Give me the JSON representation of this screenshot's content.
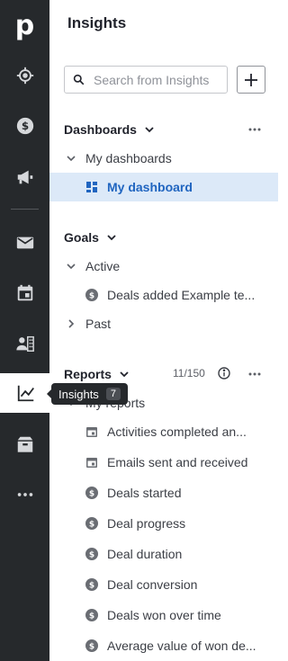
{
  "rail": {
    "logo": "p",
    "items": [
      {
        "icon": "target-icon",
        "name": "leads"
      },
      {
        "icon": "dollar-icon",
        "name": "deals"
      },
      {
        "icon": "megaphone-icon",
        "name": "campaigns"
      },
      {
        "icon": "mail-icon",
        "name": "mail"
      },
      {
        "icon": "calendar-icon",
        "name": "activities"
      },
      {
        "icon": "contacts-icon",
        "name": "contacts"
      },
      {
        "icon": "chart-icon",
        "name": "insights",
        "active": true
      },
      {
        "icon": "box-icon",
        "name": "products"
      },
      {
        "icon": "more-icon",
        "name": "more"
      }
    ]
  },
  "tooltip": {
    "label": "Insights",
    "badge": "7"
  },
  "panel": {
    "title": "Insights",
    "search_placeholder": "Search from Insights"
  },
  "dashboards": {
    "heading": "Dashboards",
    "group": "My dashboards",
    "items": [
      "My dashboard"
    ]
  },
  "goals": {
    "heading": "Goals",
    "active_label": "Active",
    "active_items": [
      "Deals added Example te..."
    ],
    "past_label": "Past"
  },
  "reports": {
    "heading": "Reports",
    "count": "11/150",
    "group": "My reports",
    "items": [
      {
        "icon": "calendar-icon",
        "label": "Activities completed an..."
      },
      {
        "icon": "calendar-icon",
        "label": "Emails sent and received"
      },
      {
        "icon": "dollar-icon",
        "label": "Deals started"
      },
      {
        "icon": "dollar-icon",
        "label": "Deal progress"
      },
      {
        "icon": "dollar-icon",
        "label": "Deal duration"
      },
      {
        "icon": "dollar-icon",
        "label": "Deal conversion"
      },
      {
        "icon": "dollar-icon",
        "label": "Deals won over time"
      },
      {
        "icon": "dollar-icon",
        "label": "Average value of won de..."
      }
    ]
  },
  "colors": {
    "rail_bg": "#26292c",
    "selected_bg": "#dce9f8",
    "selected_text": "#2065c0"
  }
}
